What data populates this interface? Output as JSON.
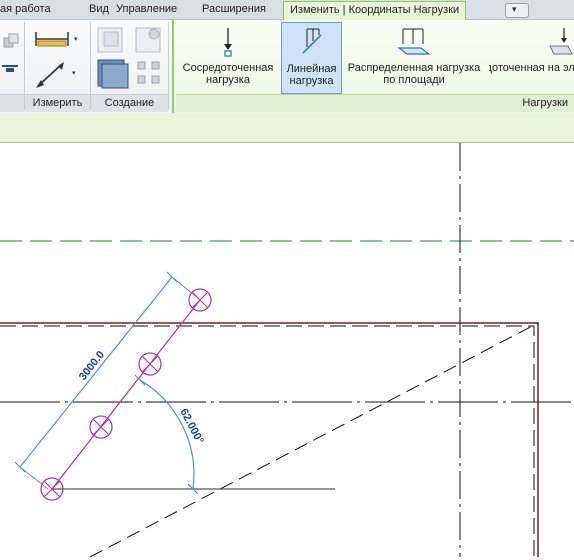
{
  "tabs": [
    {
      "label": "ая работа",
      "active": false
    },
    {
      "label": "Вид",
      "active": false
    },
    {
      "label": "Управление",
      "active": false
    },
    {
      "label": "Расширения",
      "active": false
    },
    {
      "label": "Изменить | Координаты Нагрузки",
      "active": true
    }
  ],
  "ribbon": {
    "groups": {
      "measure": "Измерить",
      "create": "Создание",
      "loads": "Нагрузки"
    },
    "buttons": {
      "point_load": "Сосредоточенная нагрузка",
      "line_load": "Линейная нагрузка",
      "area_load": "Распределенная нагрузка по площади",
      "hosted_point_load": "Сосредоточенная на эле"
    }
  },
  "canvas": {
    "dimension_length": "3000.0",
    "angle": "62.000°"
  },
  "colors": {
    "active_tab_bg": "#e8f6d8",
    "context_ribbon": "#eef7e4",
    "pressed_button": "#cfe3f7",
    "load_line": "#b23ab5",
    "dimension": "#4a90e2",
    "dim_text": "#1a3fa6",
    "wall": "#7a1f1f",
    "level_line": "#1a8a1a"
  }
}
